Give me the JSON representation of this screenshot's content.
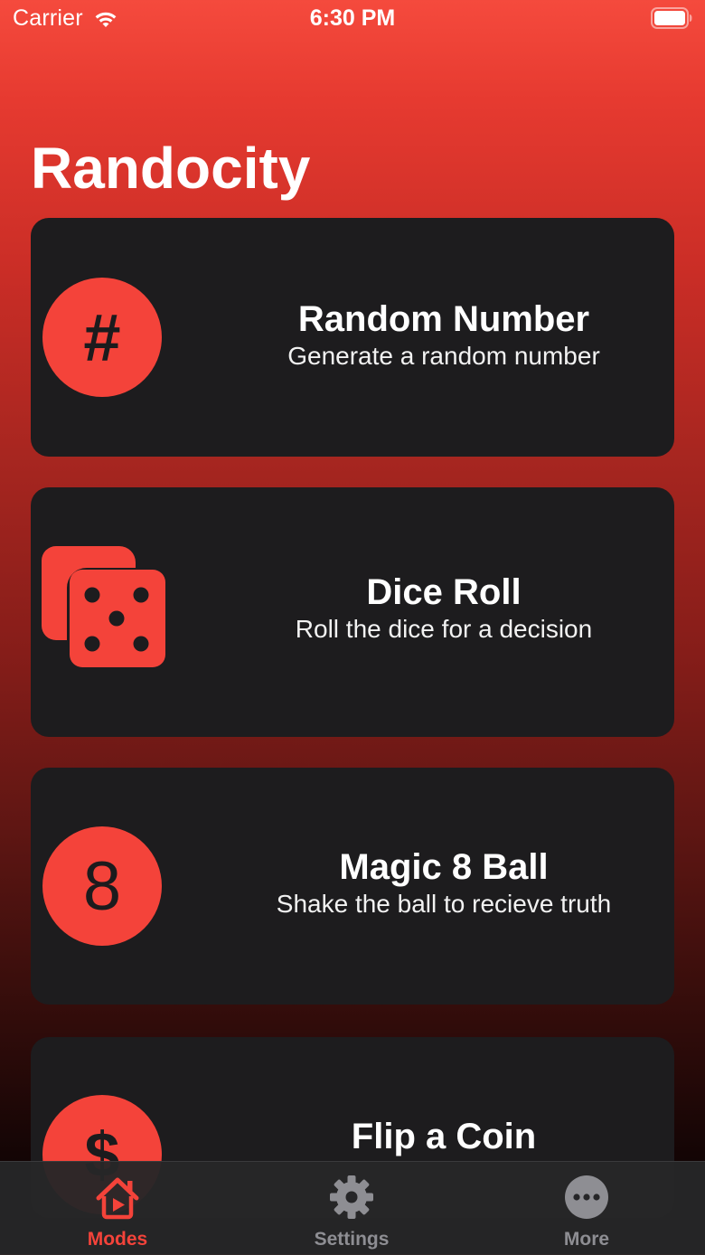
{
  "status_bar": {
    "carrier": "Carrier",
    "time": "6:30 PM",
    "wifi_icon": "wifi-icon",
    "battery_icon": "battery-full-icon"
  },
  "app": {
    "title": "Randocity",
    "accent_color": "#f4433a",
    "card_color": "#1d1c1e"
  },
  "modes": [
    {
      "title": "Random Number",
      "subtitle": "Generate a random number",
      "icon": "hash-icon",
      "glyph": "#"
    },
    {
      "title": "Dice Roll",
      "subtitle": "Roll the dice for a decision",
      "icon": "dice-icon"
    },
    {
      "title": "Magic 8 Ball",
      "subtitle": "Shake the ball to recieve truth",
      "icon": "eight-ball-icon",
      "glyph": "8"
    },
    {
      "title": "Flip a Coin",
      "subtitle": "",
      "icon": "dollar-coin-icon",
      "glyph": "$"
    }
  ],
  "tab_bar": {
    "tabs": [
      {
        "label": "Modes",
        "icon": "house-play-icon",
        "selected": true
      },
      {
        "label": "Settings",
        "icon": "gear-icon",
        "selected": false
      },
      {
        "label": "More",
        "icon": "ellipsis-circle-icon",
        "selected": false
      }
    ]
  }
}
